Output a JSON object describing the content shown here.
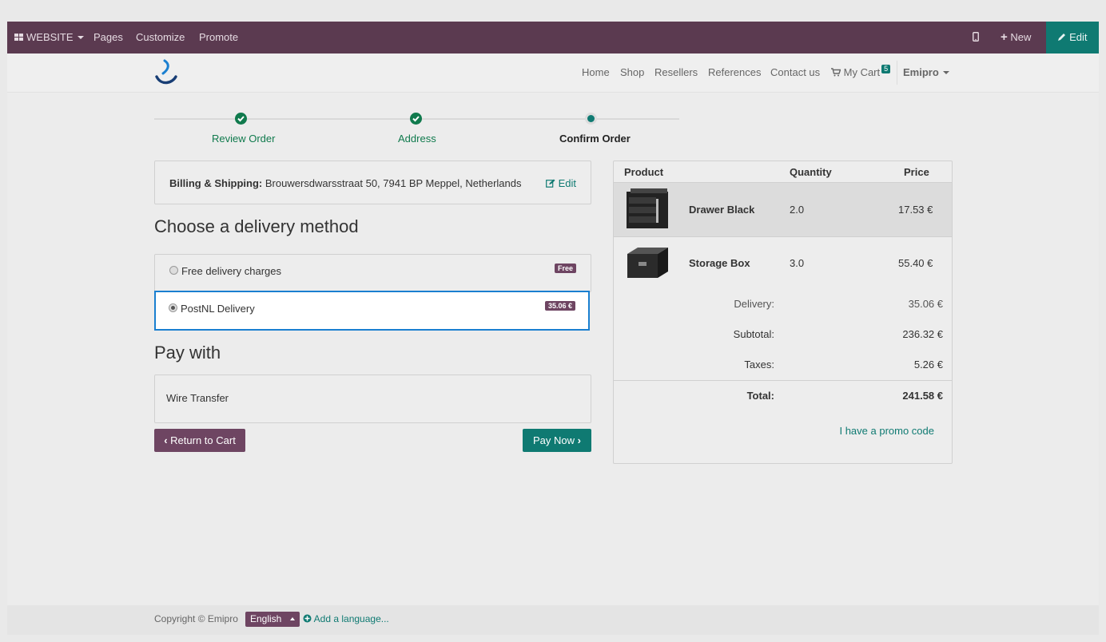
{
  "admin": {
    "website": "WEBSITE",
    "pages": "Pages",
    "customize": "Customize",
    "promote": "Promote",
    "new": "New",
    "edit": "Edit"
  },
  "nav": {
    "items": [
      "Home",
      "Shop",
      "Resellers",
      "References",
      "Contact us"
    ],
    "cart_label": "My Cart",
    "cart_count": "5",
    "user": "Emipro"
  },
  "wizard": {
    "steps": [
      "Review Order",
      "Address",
      "Confirm Order"
    ]
  },
  "billing": {
    "label": "Billing & Shipping:",
    "address": "Brouwersdwarsstraat 50, 7941 BP Meppel, Netherlands",
    "edit": "Edit"
  },
  "delivery": {
    "heading": "Choose a delivery method",
    "options": [
      {
        "label": "Free delivery charges",
        "badge": "Free",
        "selected": false
      },
      {
        "label": "PostNL Delivery",
        "badge": "35.06 €",
        "selected": true
      }
    ]
  },
  "pay": {
    "heading": "Pay with",
    "method": "Wire Transfer",
    "return": "Return to Cart",
    "paynow": "Pay Now"
  },
  "order": {
    "headers": [
      "Product",
      "Quantity",
      "Price"
    ],
    "rows": [
      {
        "name": "Drawer Black",
        "qty": "2.0",
        "price": "17.53 €"
      },
      {
        "name": "Storage Box",
        "qty": "3.0",
        "price": "55.40 €"
      }
    ],
    "delivery_label": "Delivery:",
    "delivery_value": "35.06 €",
    "subtotal_label": "Subtotal:",
    "subtotal_value": "236.32 €",
    "taxes_label": "Taxes:",
    "taxes_value": "5.26 €",
    "total_label": "Total:",
    "total_value": "241.58 €",
    "promo": "I have a promo code"
  },
  "footer": {
    "copyright": "Copyright © Emipro",
    "language": "English",
    "add_language": "Add a language..."
  },
  "colors": {
    "admin_bar": "#5b3a50",
    "accent": "#0f7a72",
    "step_done": "#107a4d",
    "badge": "#6e4562",
    "selected_border": "#1a7fd0"
  }
}
